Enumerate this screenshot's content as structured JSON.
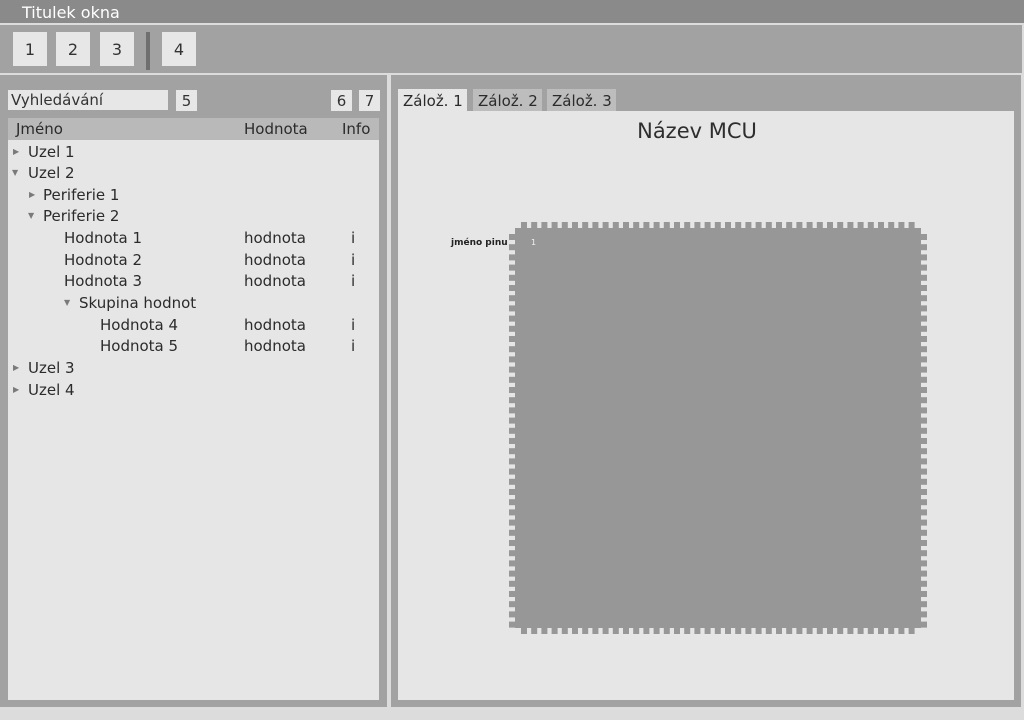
{
  "window": {
    "title": "Titulek okna"
  },
  "toolbar": {
    "buttons": [
      "1",
      "2",
      "3",
      "4"
    ]
  },
  "left_panel": {
    "search": {
      "placeholder": "Vyhledávání",
      "value": ""
    },
    "buttons": [
      "5",
      "6",
      "7"
    ],
    "tree": {
      "columns": [
        "Jméno",
        "Hodnota",
        "Info"
      ],
      "rows": [
        {
          "label": "Uzel 1",
          "value": "",
          "info": "",
          "expanded": false
        },
        {
          "label": "Uzel 2",
          "value": "",
          "info": "",
          "expanded": true
        },
        {
          "label": "Periferie 1",
          "value": "",
          "info": "",
          "expanded": false
        },
        {
          "label": "Periferie 2",
          "value": "",
          "info": "",
          "expanded": true
        },
        {
          "label": "Hodnota 1",
          "value": "hodnota",
          "info": "i"
        },
        {
          "label": "Hodnota 2",
          "value": "hodnota",
          "info": "i"
        },
        {
          "label": "Hodnota 3",
          "value": "hodnota",
          "info": "i"
        },
        {
          "label": "Skupina hodnot",
          "value": "",
          "info": "",
          "expanded": true
        },
        {
          "label": "Hodnota 4",
          "value": "hodnota",
          "info": "i"
        },
        {
          "label": "Hodnota 5",
          "value": "hodnota",
          "info": "i"
        },
        {
          "label": "Uzel 3",
          "value": "",
          "info": "",
          "expanded": false
        },
        {
          "label": "Uzel 4",
          "value": "",
          "info": "",
          "expanded": false
        }
      ]
    }
  },
  "right_panel": {
    "tabs": [
      "Zálož. 1",
      "Zálož. 2",
      "Zálož. 3"
    ],
    "active_tab": 0,
    "mcu": {
      "title": "Název MCU",
      "pin_label": "jméno pinu",
      "pin_number": "1"
    }
  },
  "colors": {
    "titlebar": "#8a8a8a",
    "panel": "#a2a2a2",
    "content": "#e6e6e6",
    "chip": "#979797"
  }
}
